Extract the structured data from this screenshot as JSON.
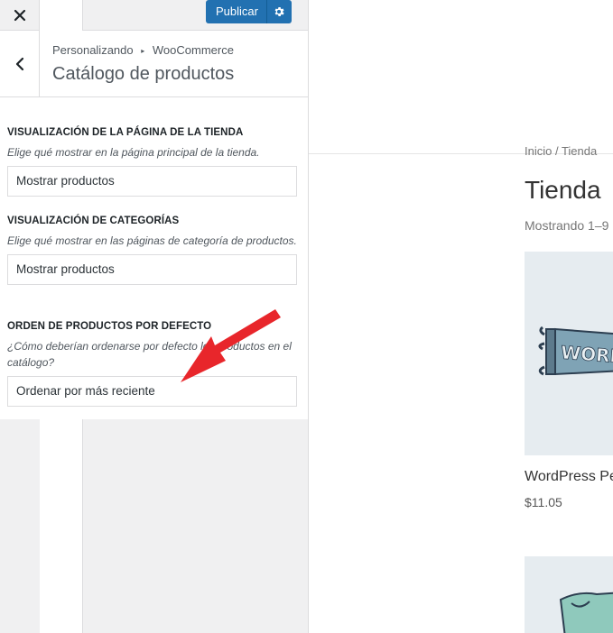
{
  "topbar": {
    "close_icon": "close-icon",
    "preview_icon": "device-toggle-icon",
    "publish_label": "Publicar",
    "gear_icon": "gear-icon"
  },
  "section": {
    "breadcrumb_parent": "Personalizando",
    "breadcrumb_sep": "▸",
    "breadcrumb_current": "WooCommerce",
    "title": "Catálogo de productos"
  },
  "controls": [
    {
      "label": "VISUALIZACIÓN DE LA PÁGINA DE LA TIENDA",
      "description": "Elige qué mostrar en la página principal de la tienda.",
      "value": "Mostrar productos"
    },
    {
      "label": "VISUALIZACIÓN DE CATEGORÍAS",
      "description": "Elige qué mostrar en las páginas de categoría de productos.",
      "value": "Mostrar productos"
    },
    {
      "label": "ORDEN DE PRODUCTOS POR DEFECTO",
      "description": "¿Cómo deberían ordenarse por defecto los productos en el catálogo?",
      "value": "Ordenar por más reciente"
    }
  ],
  "preview": {
    "breadcrumb": "Inicio / Tienda",
    "shop_title": "Tienda",
    "result_count": "Mostrando 1–9",
    "product_1_name": "WordPress Pe",
    "product_1_price": "$11.05"
  },
  "colors": {
    "accent": "#2271b1",
    "annotation_arrow": "#e8262b"
  }
}
